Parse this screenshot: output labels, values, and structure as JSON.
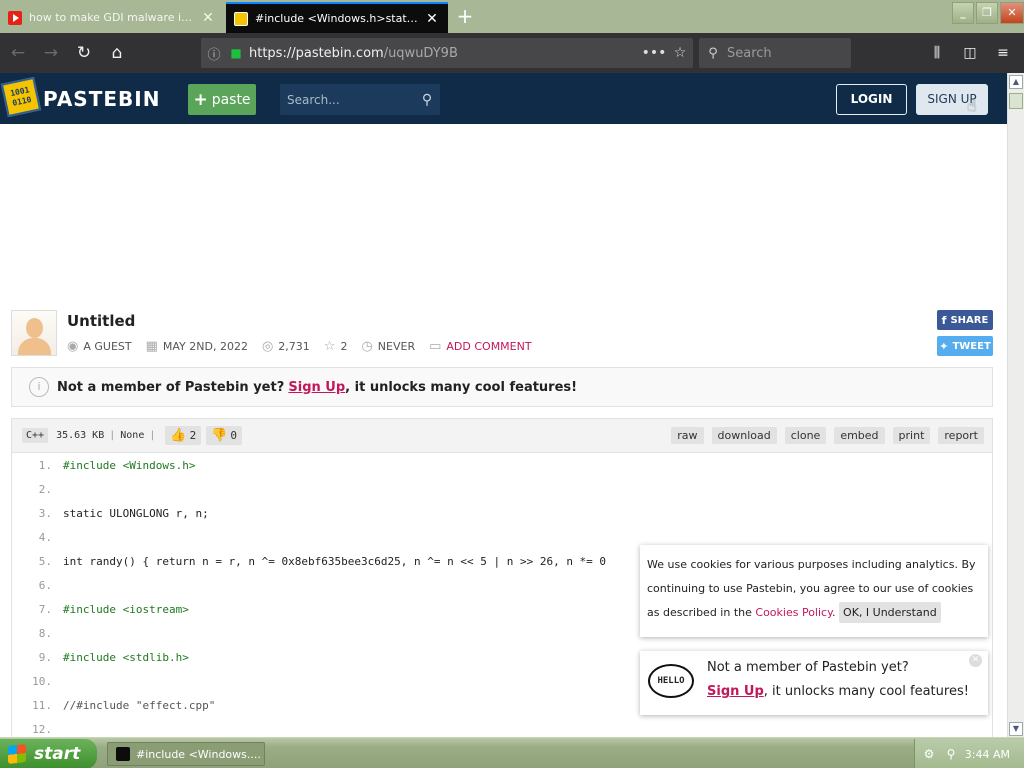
{
  "browser": {
    "tabs": [
      {
        "title": "how to make GDI malware in c++",
        "active": false,
        "favicon": "youtube-icon"
      },
      {
        "title": "#include <Windows.h>static ULO",
        "active": true,
        "favicon": "pastebin-icon"
      }
    ],
    "url_host": "https://pastebin.com",
    "url_path": "/uqwuDY9B",
    "search_placeholder": "Search"
  },
  "site": {
    "logo_text": "1001 0110",
    "name": "PASTEBIN",
    "paste_button": "paste",
    "search_placeholder": "Search...",
    "login": "LOGIN",
    "signup": "SIGN UP"
  },
  "paste": {
    "title": "Untitled",
    "author": "A GUEST",
    "date": "MAY 2ND, 2022",
    "views": "2,731",
    "stars": "2",
    "expiry": "NEVER",
    "add_comment": "ADD COMMENT",
    "share": "SHARE",
    "tweet": "TWEET"
  },
  "notice": {
    "prefix": "Not a member of Pastebin yet?",
    "link": "Sign Up",
    "suffix": ", it unlocks many cool features!"
  },
  "codebar": {
    "language": "C++",
    "size": "35.63 KB",
    "category": "None",
    "likes": "2",
    "dislikes": "0",
    "tools": [
      "raw",
      "download",
      "clone",
      "embed",
      "print",
      "report"
    ]
  },
  "code_lines": [
    {
      "n": "1.",
      "text": "#include <Windows.h>"
    },
    {
      "n": "2.",
      "text": ""
    },
    {
      "n": "3.",
      "text": "static ULONGLONG r, n;"
    },
    {
      "n": "4.",
      "text": ""
    },
    {
      "n": "5.",
      "text": "int randy() { return n = r, n ^= 0x8ebf635bee3c6d25, n ^= n << 5 | n >> 26, n *= 0"
    },
    {
      "n": "6.",
      "text": ""
    },
    {
      "n": "7.",
      "text": "#include <iostream>"
    },
    {
      "n": "8.",
      "text": ""
    },
    {
      "n": "9.",
      "text": "#include <stdlib.h>"
    },
    {
      "n": "10.",
      "text": ""
    },
    {
      "n": "11.",
      "text": "//#include \"effect.cpp\""
    },
    {
      "n": "12.",
      "text": ""
    }
  ],
  "cookie": {
    "text": "We use cookies for various purposes including analytics. By continuing to use Pastebin, you agree to our use of cookies as described in the",
    "link": "Cookies Policy",
    "button": "OK, I Understand"
  },
  "hello_popup": {
    "badge": "HELLO",
    "line1": "Not a member of Pastebin yet?",
    "link": "Sign Up",
    "suffix": ", it unlocks many cool features!"
  },
  "taskbar": {
    "start": "start",
    "item": "#include <Windows....",
    "clock": "3:44 AM"
  }
}
